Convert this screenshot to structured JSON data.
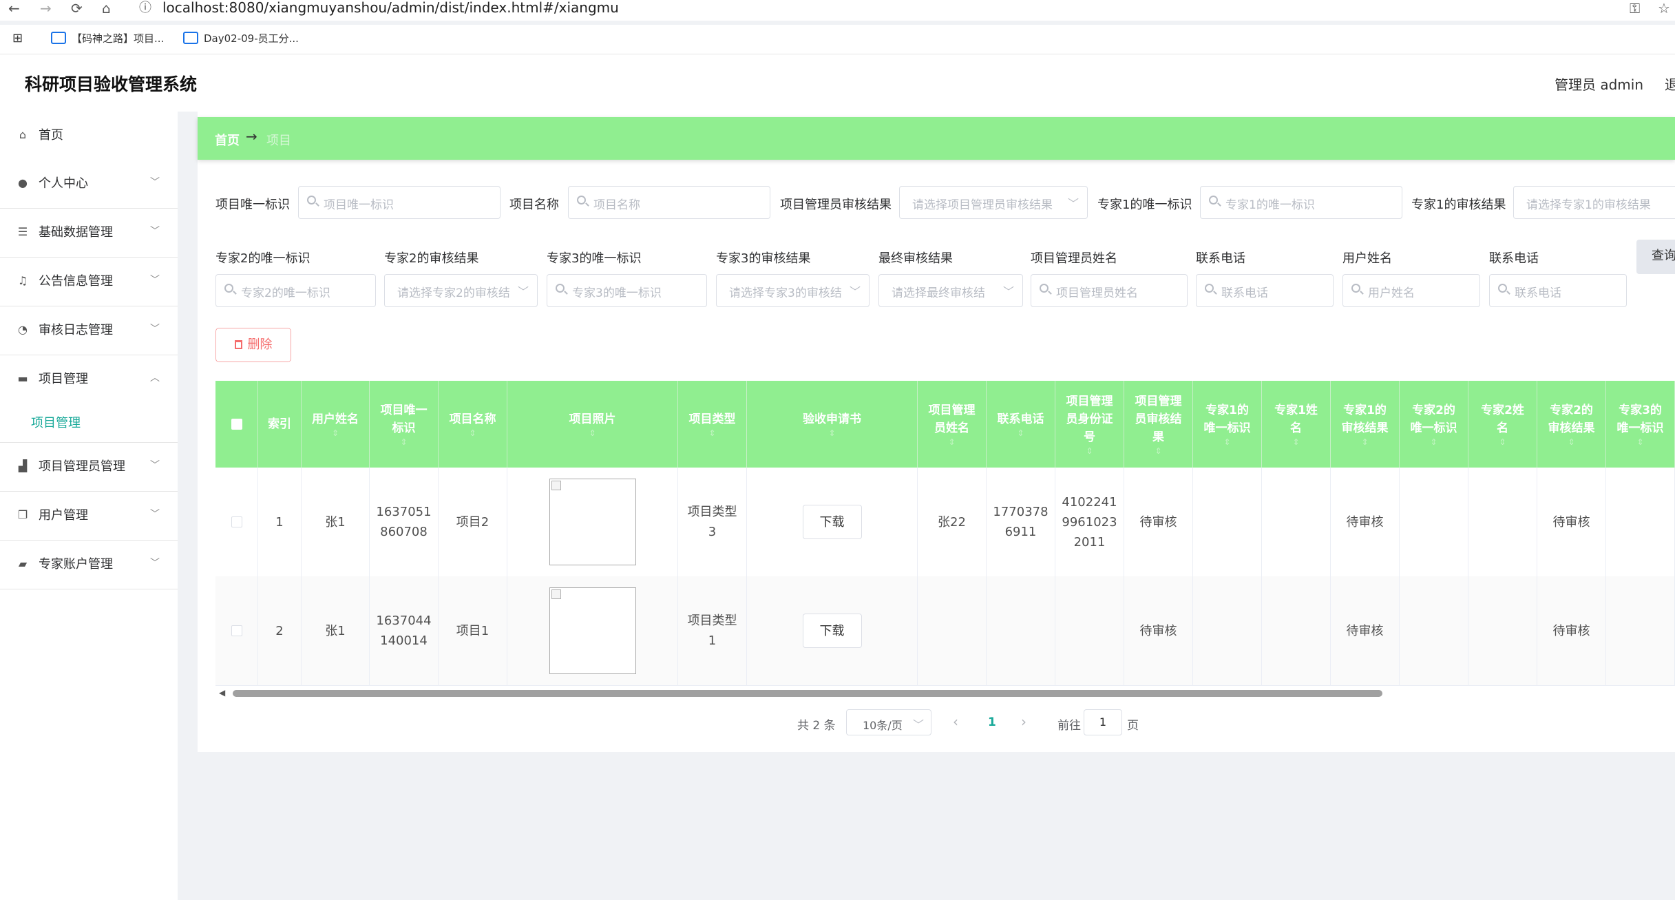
{
  "browser": {
    "url": "localhost:8080/xiangmuyanshou/admin/dist/index.html#/xiangmu",
    "bookmarks": [
      "【码神之路】项目...",
      "Day02-09-员工分..."
    ]
  },
  "header": {
    "title": "科研项目验收管理系统",
    "user": "管理员 admin",
    "logout": "退"
  },
  "sidebar": {
    "items": [
      {
        "label": "首页",
        "icon": "home-icon"
      },
      {
        "label": "个人中心",
        "icon": "user-icon"
      },
      {
        "label": "基础数据管理",
        "icon": "list-icon"
      },
      {
        "label": "公告信息管理",
        "icon": "bell-icon"
      },
      {
        "label": "审核日志管理",
        "icon": "compass-icon"
      },
      {
        "label": "项目管理",
        "icon": "briefcase-icon"
      },
      {
        "label": "项目管理员管理",
        "icon": "bank-icon"
      },
      {
        "label": "用户管理",
        "icon": "copy-icon"
      },
      {
        "label": "专家账户管理",
        "icon": "ticket-icon"
      }
    ],
    "submenu_active": "项目管理"
  },
  "breadcrumb": {
    "home": "首页",
    "sep": "→",
    "current": "项目"
  },
  "search": {
    "row1": [
      {
        "label": "项目唯一标识",
        "placeholder": "项目唯一标识"
      },
      {
        "label": "项目名称",
        "placeholder": "项目名称"
      },
      {
        "label": "项目管理员审核结果",
        "placeholder": "请选择项目管理员审核结果"
      },
      {
        "label": "专家1的唯一标识",
        "placeholder": "专家1的唯一标识"
      },
      {
        "label": "专家1的审核结果",
        "placeholder": "请选择专家1的审核结果"
      }
    ],
    "row2": [
      {
        "label": "专家2的唯一标识",
        "placeholder": "专家2的唯一标识"
      },
      {
        "label": "专家2的审核结果",
        "placeholder": "请选择专家2的审核结"
      },
      {
        "label": "专家3的唯一标识",
        "placeholder": "专家3的唯一标识"
      },
      {
        "label": "专家3的审核结果",
        "placeholder": "请选择专家3的审核结"
      },
      {
        "label": "最终审核结果",
        "placeholder": "请选择最终审核结"
      },
      {
        "label": "项目管理员姓名",
        "placeholder": "项目管理员姓名"
      },
      {
        "label": "联系电话",
        "placeholder": "联系电话"
      },
      {
        "label": "用户姓名",
        "placeholder": "用户姓名"
      },
      {
        "label": "联系电话",
        "placeholder": "联系电话"
      }
    ],
    "query_button": "查询",
    "delete_button": "删除"
  },
  "table": {
    "headers": [
      "",
      "索引",
      "用户姓名",
      "项目唯一标识",
      "项目名称",
      "项目照片",
      "项目类型",
      "验收申请书",
      "项目管理员姓名",
      "联系电话",
      "项目管理员身份证号",
      "项目管理员审核结果",
      "专家1的唯一标识",
      "专家1姓名",
      "专家1的审核结果",
      "专家2的唯一标识",
      "专家2姓名",
      "专家2的审核结果",
      "专家3的唯一标识"
    ],
    "header_lines": [
      [
        ""
      ],
      [
        "索引"
      ],
      [
        "用户姓名"
      ],
      [
        "项目唯一",
        "标识"
      ],
      [
        "项目名称"
      ],
      [
        "项目照片"
      ],
      [
        "项目类型"
      ],
      [
        "验收申请书"
      ],
      [
        "项目管理",
        "员姓名"
      ],
      [
        "联系电话"
      ],
      [
        "项目管理",
        "员身份证",
        "号"
      ],
      [
        "项目管理",
        "员审核结",
        "果"
      ],
      [
        "专家1的",
        "唯一标识"
      ],
      [
        "专家1姓",
        "名"
      ],
      [
        "专家1的",
        "审核结果"
      ],
      [
        "专家2的",
        "唯一标识"
      ],
      [
        "专家2姓",
        "名"
      ],
      [
        "专家2的",
        "审核结果"
      ],
      [
        "专家3的",
        "唯一标识"
      ]
    ],
    "rows": [
      {
        "index": "1",
        "user": "张1",
        "project_id": [
          "1637051",
          "860708"
        ],
        "name": "项目2",
        "type": [
          "项目类型",
          "3"
        ],
        "download": "下载",
        "admin_name": "张22",
        "phone": [
          "1770378",
          "6911"
        ],
        "idcard": [
          "4102241",
          "9961023",
          "2011"
        ],
        "admin_result": "待审核",
        "e1_id": "",
        "e1_name": "",
        "e1_result": "待审核",
        "e2_id": "",
        "e2_name": "",
        "e2_result": "待审核",
        "e3_id": ""
      },
      {
        "index": "2",
        "user": "张1",
        "project_id": [
          "1637044",
          "140014"
        ],
        "name": "项目1",
        "type": [
          "项目类型",
          "1"
        ],
        "download": "下载",
        "admin_name": "",
        "phone": [],
        "idcard": [],
        "admin_result": "待审核",
        "e1_id": "",
        "e1_name": "",
        "e1_result": "待审核",
        "e2_id": "",
        "e2_name": "",
        "e2_result": "待审核",
        "e3_id": ""
      }
    ]
  },
  "pagination": {
    "total": "共 2 条",
    "page_size": "10条/页",
    "current": "1",
    "goto_label": "前往",
    "goto_value": "1",
    "page_label": "页"
  },
  "colors": {
    "accent_green": "#90ee90",
    "active_teal": "#18a999",
    "danger": "#f56c6c"
  }
}
